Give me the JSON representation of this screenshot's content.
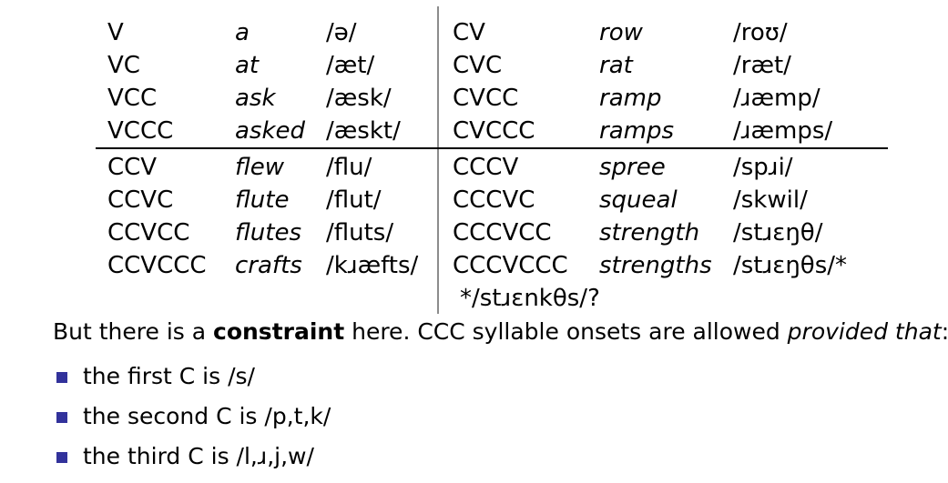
{
  "slide": {
    "table": {
      "columns": [
        "pattern",
        "word",
        "ipa"
      ],
      "divider_color": "#8c8c8c",
      "rule_color": "#000000",
      "left_top": [
        {
          "pattern": "V",
          "word": "a",
          "ipa": "/ə/"
        },
        {
          "pattern": "VC",
          "word": "at",
          "ipa": "/æt/"
        },
        {
          "pattern": "VCC",
          "word": "ask",
          "ipa": "/æsk/"
        },
        {
          "pattern": "VCCC",
          "word": "asked",
          "ipa": "/æskt/"
        }
      ],
      "right_top": [
        {
          "pattern": "CV",
          "word": "row",
          "ipa": "/roʊ/"
        },
        {
          "pattern": "CVC",
          "word": "rat",
          "ipa": "/ræt/"
        },
        {
          "pattern": "CVCC",
          "word": "ramp",
          "ipa": "/ɹæmp/"
        },
        {
          "pattern": "CVCCC",
          "word": "ramps",
          "ipa": "/ɹæmps/"
        }
      ],
      "left_bottom": [
        {
          "pattern": "CCV",
          "word": "flew",
          "ipa": "/flu/"
        },
        {
          "pattern": "CCVC",
          "word": "flute",
          "ipa": "/flut/"
        },
        {
          "pattern": "CCVCC",
          "word": "flutes",
          "ipa": "/fluts/"
        },
        {
          "pattern": "CCVCCC",
          "word": "crafts",
          "ipa": "/kɹæfts/"
        }
      ],
      "right_bottom": [
        {
          "pattern": "CCCV",
          "word": "spree",
          "ipa": "/spɹi/"
        },
        {
          "pattern": "CCCVC",
          "word": "squeal",
          "ipa": "/skwil/"
        },
        {
          "pattern": "CCCVCC",
          "word": "strength",
          "ipa": "/stɹɛŋθ/"
        },
        {
          "pattern": "CCCVCCC",
          "word": "strengths",
          "ipa": "/stɹɛŋθs/*"
        }
      ],
      "continuation": "*/stɹɛnkθs/?"
    },
    "paragraph": {
      "part1": "But there is a ",
      "bold": "constraint",
      "part2": " here.  CCC syllable onsets are allowed ",
      "italic": "provided that",
      "part3": ":"
    },
    "bullets": {
      "marker_color": "#32329b",
      "items": [
        {
          "text": "the first C is /s/"
        },
        {
          "text": "the second C is /p,t,k/"
        },
        {
          "text": "the third C is /l,ɹ,j,w/"
        }
      ]
    }
  }
}
